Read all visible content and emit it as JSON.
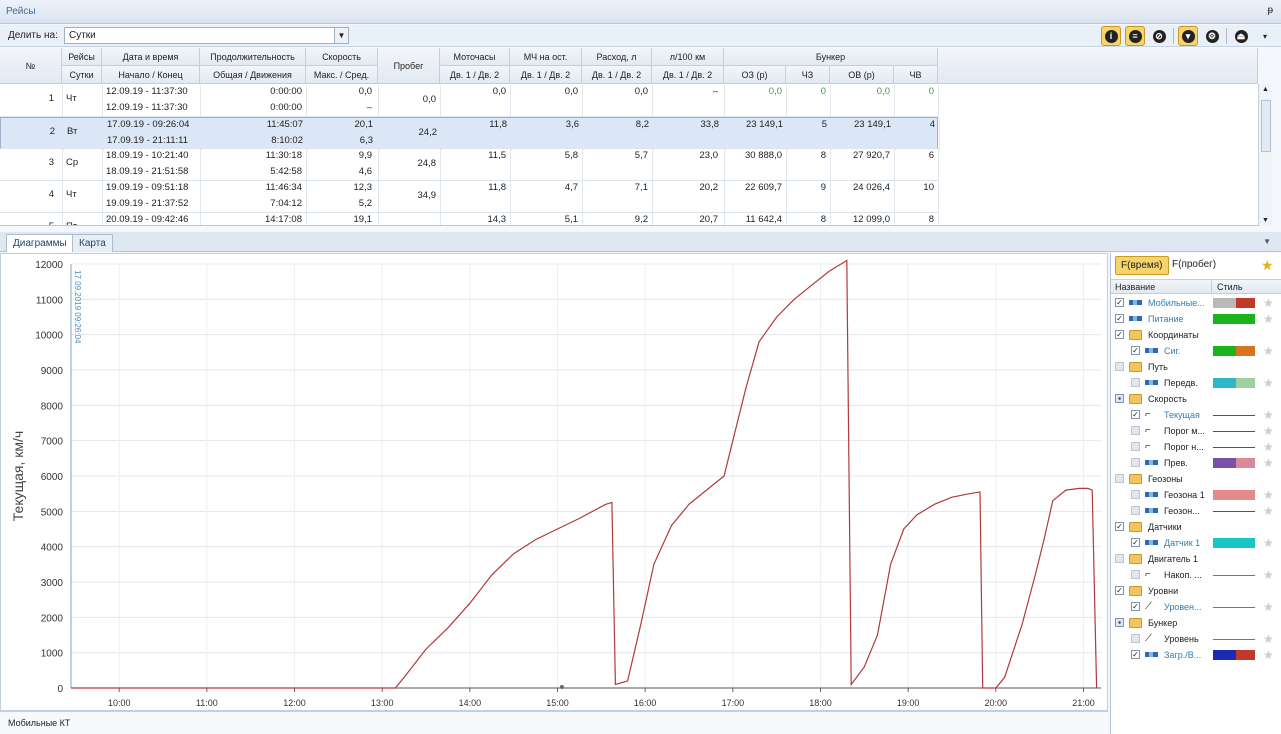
{
  "window": {
    "title": "Рейсы",
    "pin": "ᵽ"
  },
  "toolbar": {
    "split_label": "Делить на:",
    "split_value": "Сутки"
  },
  "grid": {
    "headers_top": [
      "№",
      "Рейсы",
      "Дата и время",
      "Продолжительность",
      "Скорость",
      "Пробег",
      "Моточасы",
      "МЧ на ост.",
      "Расход, л",
      "л/100 км",
      "Бункер"
    ],
    "headers_sub": [
      "Сутки",
      "Начало / Конец",
      "Общая / Движения",
      "Макс. / Сред.",
      "Дв. 1 / Дв. 2",
      "Дв. 1 / Дв. 2",
      "Дв. 1 / Дв. 2",
      "Дв. 1 / Дв. 2",
      "ОЗ (р)",
      "ЧЗ",
      "ОВ (р)",
      "ЧВ"
    ],
    "rows": [
      {
        "n": "1",
        "day": "Чт",
        "start": "12.09.19 - 11:37:30",
        "end": "12.09.19 - 11:37:30",
        "dur_total": "0:00:00",
        "dur_move": "0:00:00",
        "v_max": "0,0",
        "v_avg": "–",
        "mileage": "0,0",
        "mh": "0,0",
        "mh_idle": "0,0",
        "fuel": "0,0",
        "l100": "–",
        "oz": "0,0",
        "cz": "0",
        "ov": "0,0",
        "cv": "0"
      },
      {
        "n": "2",
        "day": "Вт",
        "start": "17.09.19 - 09:26:04",
        "end": "17.09.19 - 21:11:11",
        "dur_total": "11:45:07",
        "dur_move": "8:10:02",
        "v_max": "20,1",
        "v_avg": "6,3",
        "mileage": "24,2",
        "mh": "11,8",
        "mh_idle": "3,6",
        "fuel": "8,2",
        "l100": "33,8",
        "oz": "23 149,1",
        "cz": "5",
        "ov": "23 149,1",
        "cv": "4"
      },
      {
        "n": "3",
        "day": "Ср",
        "start": "18.09.19 - 10:21:40",
        "end": "18.09.19 - 21:51:58",
        "dur_total": "11:30:18",
        "dur_move": "5:42:58",
        "v_max": "9,9",
        "v_avg": "4,6",
        "mileage": "24,8",
        "mh": "11,5",
        "mh_idle": "5,8",
        "fuel": "5,7",
        "l100": "23,0",
        "oz": "30 888,0",
        "cz": "8",
        "ov": "27 920,7",
        "cv": "6"
      },
      {
        "n": "4",
        "day": "Чт",
        "start": "19.09.19 - 09:51:18",
        "end": "19.09.19 - 21:37:52",
        "dur_total": "11:46:34",
        "dur_move": "7:04:12",
        "v_max": "12,3",
        "v_avg": "5,2",
        "mileage": "34,9",
        "mh": "11,8",
        "mh_idle": "4,7",
        "fuel": "7,1",
        "l100": "20,2",
        "oz": "22 609,7",
        "cz": "9",
        "ov": "24 026,4",
        "cv": "10"
      },
      {
        "n": "5",
        "day": "Пт",
        "start": "20.09.19 - 09:42:46",
        "end": "",
        "dur_total": "14:17:08",
        "dur_move": "",
        "v_max": "19,1",
        "v_avg": "",
        "mileage": "",
        "mh": "14,3",
        "mh_idle": "5,1",
        "fuel": "9,2",
        "l100": "20,7",
        "oz": "11 642,4",
        "cz": "8",
        "ov": "12 099,0",
        "cv": "8"
      }
    ]
  },
  "tabs": {
    "diagrams": "Диаграммы",
    "map": "Карта"
  },
  "chart_data": {
    "type": "line",
    "ylabel": "Текущая, км/ч",
    "ylim": [
      0,
      12000
    ],
    "yticks": [
      "0",
      "1000",
      "2000",
      "3000",
      "4000",
      "5000",
      "6000",
      "7000",
      "8000",
      "9000",
      "10000",
      "11000",
      "12000"
    ],
    "xlim": [
      9.45,
      21.2
    ],
    "xticks": [
      "10:00",
      "11:00",
      "12:00",
      "13:00",
      "14:00",
      "15:00",
      "16:00",
      "17:00",
      "18:00",
      "19:00",
      "20:00",
      "21:00"
    ],
    "marker_label": "17.09.2019 09:26:04",
    "series": [
      {
        "x": [
          9.45,
          13.15,
          13.25,
          13.5,
          13.75,
          14.0,
          14.25,
          14.5,
          14.75,
          15.0,
          15.25,
          15.55,
          15.62,
          15.66,
          15.8,
          15.95,
          16.1,
          16.3,
          16.5,
          16.7,
          16.85,
          16.9,
          17.0,
          17.15,
          17.3,
          17.5,
          17.7,
          17.9,
          18.1,
          18.3,
          18.35,
          18.5,
          18.65,
          18.8,
          18.95,
          19.1,
          19.3,
          19.5,
          19.7,
          19.82,
          19.85,
          20.0,
          20.1,
          20.3,
          20.45,
          20.55,
          20.65,
          20.8,
          20.95,
          21.05,
          21.1,
          21.15
        ],
        "y": [
          0,
          0,
          300,
          1100,
          1700,
          2400,
          3200,
          3800,
          4200,
          4500,
          4800,
          5200,
          5250,
          100,
          200,
          1800,
          3500,
          4600,
          5200,
          5600,
          5900,
          6000,
          7000,
          8500,
          9800,
          10500,
          11000,
          11400,
          11800,
          12100,
          100,
          600,
          1500,
          3500,
          4500,
          4900,
          5200,
          5400,
          5500,
          5550,
          0,
          0,
          300,
          1800,
          3200,
          4200,
          5300,
          5600,
          5650,
          5650,
          5600,
          0
        ]
      }
    ]
  },
  "strip": {
    "label": "Мобильные КТ"
  },
  "panel": {
    "tab_time": "F(время)",
    "tab_mileage": "F(пробег)",
    "col_name": "Название",
    "col_style": "Стиль",
    "items": [
      {
        "label": "Мобильные...",
        "kind": "series",
        "indent": 1,
        "checked": "on",
        "swatch": "#b9b9b9",
        "swatch2": "#c0392b"
      },
      {
        "label": "Питание",
        "kind": "series",
        "indent": 1,
        "checked": "on",
        "swatch": "#1db31d"
      },
      {
        "label": "Координаты",
        "kind": "folder",
        "indent": 1,
        "checked": "on"
      },
      {
        "label": "Сиг.",
        "kind": "series",
        "indent": 2,
        "checked": "on",
        "swatch": "#1db31d",
        "swatch2": "#d8731e"
      },
      {
        "label": "Путь",
        "kind": "folder",
        "indent": 1,
        "checked": "dis"
      },
      {
        "label": "Передв.",
        "kind": "series",
        "indent": 2,
        "checked": "dis",
        "swatch": "#2fb7c9",
        "swatch2": "#9fd0a0"
      },
      {
        "label": "Скорость",
        "kind": "folder",
        "indent": 1,
        "checked": "part"
      },
      {
        "label": "Текущая",
        "kind": "step",
        "indent": 2,
        "checked": "on",
        "line": "#555555"
      },
      {
        "label": "Порог м...",
        "kind": "step",
        "indent": 2,
        "checked": "dis",
        "line": "#555555"
      },
      {
        "label": "Порог н...",
        "kind": "step",
        "indent": 2,
        "checked": "dis",
        "line": "#555555"
      },
      {
        "label": "Прев.",
        "kind": "series",
        "indent": 2,
        "checked": "dis",
        "swatch": "#7a4fa8",
        "swatch2": "#d88a9a"
      },
      {
        "label": "Геозоны",
        "kind": "folder",
        "indent": 1,
        "checked": "dis"
      },
      {
        "label": "Геозона 1",
        "kind": "series",
        "indent": 2,
        "checked": "dis",
        "swatch": "#e58a8a"
      },
      {
        "label": "Геозон...",
        "kind": "series",
        "indent": 2,
        "checked": "dis",
        "line": "#555555"
      },
      {
        "label": "Датчики",
        "kind": "folder",
        "indent": 1,
        "checked": "on"
      },
      {
        "label": "Датчик 1",
        "kind": "series",
        "indent": 2,
        "checked": "on",
        "swatch": "#19c6c6"
      },
      {
        "label": "Двигатель 1",
        "kind": "folder",
        "indent": 1,
        "checked": "dis"
      },
      {
        "label": "Накоп. ...",
        "kind": "step",
        "indent": 2,
        "checked": "dis",
        "line": "#b85a5a"
      },
      {
        "label": "Уровни",
        "kind": "folder",
        "indent": 1,
        "checked": "on"
      },
      {
        "label": "Уровен...",
        "kind": "slope",
        "indent": 2,
        "checked": "on",
        "line": "#b85a5a"
      },
      {
        "label": "Бункер",
        "kind": "folder",
        "indent": 1,
        "checked": "part"
      },
      {
        "label": "Уровень",
        "kind": "slope",
        "indent": 2,
        "checked": "dis",
        "line": "#b85a5a"
      },
      {
        "label": "Загр./В...",
        "kind": "series",
        "indent": 2,
        "checked": "on",
        "swatch": "#1b2bb3",
        "swatch2": "#c0392b"
      }
    ]
  },
  "colors": {
    "accent": "#f6d36b",
    "series_line": "#b03a3a",
    "selection": "#dbe7f6",
    "link_blue": "#2b7fb8",
    "zero_green": "#3c9a3c"
  }
}
